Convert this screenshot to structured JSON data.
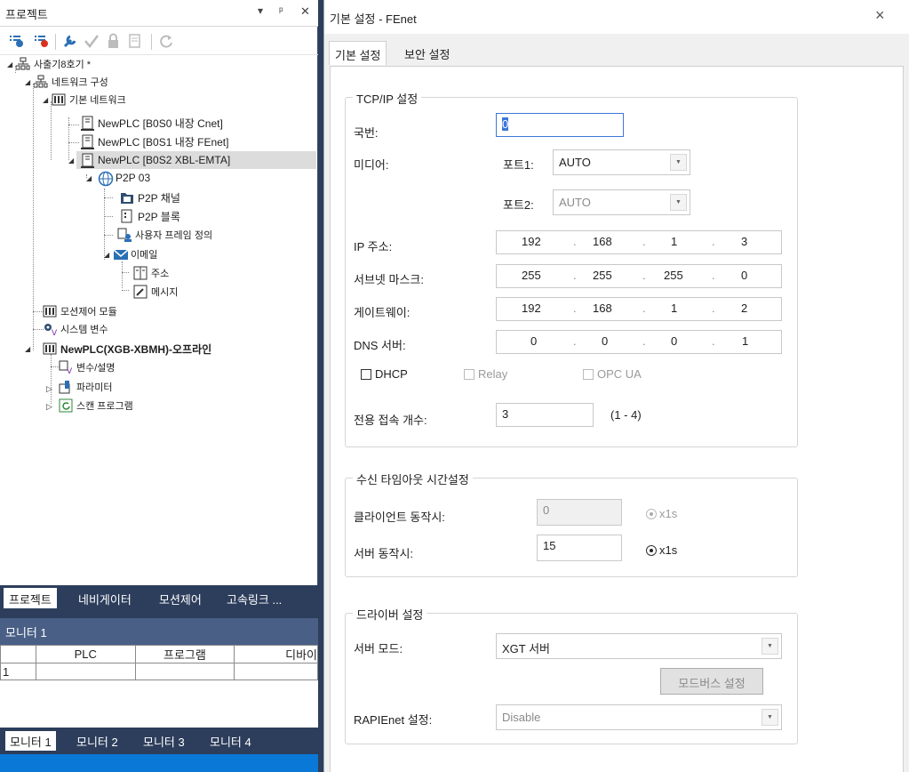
{
  "project_panel": {
    "title": "프로젝트",
    "pin_glyph": "▾ ₽ ✕",
    "tree": [
      {
        "label": "사출기8호기 *",
        "icon": "network-root-icon"
      },
      {
        "label": "네트워크 구성",
        "icon": "network-config-icon"
      },
      {
        "label": "기본 네트워크",
        "icon": "basic-network-icon"
      },
      {
        "label": "NewPLC [B0S0 내장 Cnet]",
        "icon": "plc-module-icon"
      },
      {
        "label": "NewPLC [B0S1 내장 FEnet]",
        "icon": "plc-module-icon"
      },
      {
        "label": "NewPLC [B0S2 XBL-EMTA]",
        "icon": "plc-module-icon"
      },
      {
        "label": "P2P 03",
        "icon": "globe-icon"
      },
      {
        "label": "P2P 채널",
        "icon": "p2p-channel-icon"
      },
      {
        "label": "P2P 블록",
        "icon": "p2p-block-icon"
      },
      {
        "label": "사용자 프레임 정의",
        "icon": "user-frame-icon"
      },
      {
        "label": "이메일",
        "icon": "email-icon"
      },
      {
        "label": "주소",
        "icon": "address-book-icon"
      },
      {
        "label": "메시지",
        "icon": "message-icon"
      },
      {
        "label": "모션제어 모듈",
        "icon": "motion-module-icon"
      },
      {
        "label": "시스템 변수",
        "icon": "system-variable-icon"
      },
      {
        "label": "NewPLC(XGB-XBMH)-오프라인",
        "icon": "plc-cpu-icon"
      },
      {
        "label": "변수/설명",
        "icon": "variable-icon"
      },
      {
        "label": "파라미터",
        "icon": "parameter-icon"
      },
      {
        "label": "스캔 프로그램",
        "icon": "scan-program-icon"
      }
    ],
    "tabs": [
      "프로젝트",
      "네비게이터",
      "모션제어",
      "고속링크 ..."
    ]
  },
  "monitor_panel": {
    "title": "모니터 1",
    "columns": [
      "",
      "PLC",
      "프로그램",
      "디바이"
    ],
    "rows": [
      [
        "1",
        "",
        "",
        ""
      ]
    ],
    "tabs": [
      "모니터 1",
      "모니터 2",
      "모니터 3",
      "모니터 4"
    ]
  },
  "dialog": {
    "title": "기본 설정 - FEnet",
    "close": "×",
    "tabs": [
      "기본 설정",
      "보안 설정"
    ],
    "tcpip": {
      "legend": "TCP/IP 설정",
      "station_label": "국번:",
      "station_value": "0",
      "media_label": "미디어:",
      "port1_label": "포트1:",
      "port1_value": "AUTO",
      "port2_label": "포트2:",
      "port2_value": "AUTO",
      "ip_label": "IP 주소:",
      "ip": [
        "192",
        "168",
        "1",
        "3"
      ],
      "mask_label": "서브넷 마스크:",
      "mask": [
        "255",
        "255",
        "255",
        "0"
      ],
      "gateway_label": "게이트웨이:",
      "gateway": [
        "192",
        "168",
        "1",
        "2"
      ],
      "dns_label": "DNS 서버:",
      "dns": [
        "0",
        "0",
        "0",
        "1"
      ],
      "dhcp": "DHCP",
      "relay": "Relay",
      "opcua": "OPC UA",
      "conn_label": "전용 접속 개수:",
      "conn_value": "3",
      "conn_range": "(1 - 4)",
      "dot": "."
    },
    "timeout": {
      "legend": "수신 타임아웃 시간설정",
      "client_label": "클라이언트 동작시:",
      "client_value": "0",
      "client_unit": "x1s",
      "server_label": "서버 동작시:",
      "server_value": "15",
      "server_unit": "x1s"
    },
    "driver": {
      "legend": "드라이버 설정",
      "server_mode_label": "서버 모드:",
      "server_mode_value": "XGT 서버",
      "modbus_button": "모드버스 설정",
      "rapienet_label": "RAPIEnet 설정:",
      "rapienet_value": "Disable"
    }
  }
}
